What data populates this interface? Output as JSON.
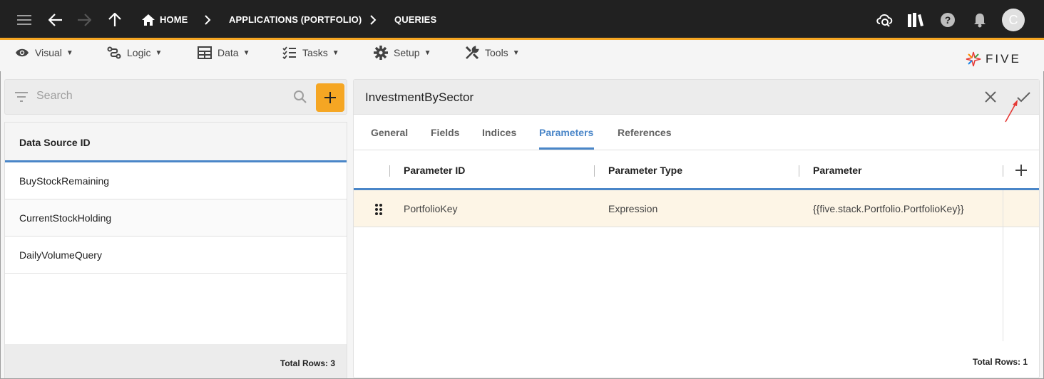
{
  "topbar": {
    "breadcrumbs": [
      "HOME",
      "APPLICATIONS (PORTFOLIO)",
      "QUERIES"
    ],
    "avatar_initial": "C"
  },
  "menu": {
    "items": [
      {
        "label": "Visual",
        "icon": "eye-icon"
      },
      {
        "label": "Logic",
        "icon": "logic-icon"
      },
      {
        "label": "Data",
        "icon": "table-icon"
      },
      {
        "label": "Tasks",
        "icon": "checklist-icon"
      },
      {
        "label": "Setup",
        "icon": "gear-icon"
      },
      {
        "label": "Tools",
        "icon": "tools-icon"
      }
    ]
  },
  "logo": {
    "text": "FIVE"
  },
  "left": {
    "search_placeholder": "Search",
    "column_header": "Data Source ID",
    "rows": [
      "BuyStockRemaining",
      "CurrentStockHolding",
      "DailyVolumeQuery"
    ],
    "footer": "Total Rows: 3"
  },
  "right": {
    "title": "InvestmentBySector",
    "tabs": [
      "General",
      "Fields",
      "Indices",
      "Parameters",
      "References"
    ],
    "active_tab": "Parameters",
    "columns": [
      "Parameter ID",
      "Parameter Type",
      "Parameter"
    ],
    "rows": [
      {
        "id": "PortfolioKey",
        "type": "Expression",
        "parameter": "{{five.stack.Portfolio.PortfolioKey}}"
      }
    ],
    "footer": "Total Rows: 1"
  },
  "colors": {
    "accent": "#f5a623",
    "primary": "#4a86c8",
    "topbar": "#212121",
    "selected_row": "#fdf5e6"
  }
}
